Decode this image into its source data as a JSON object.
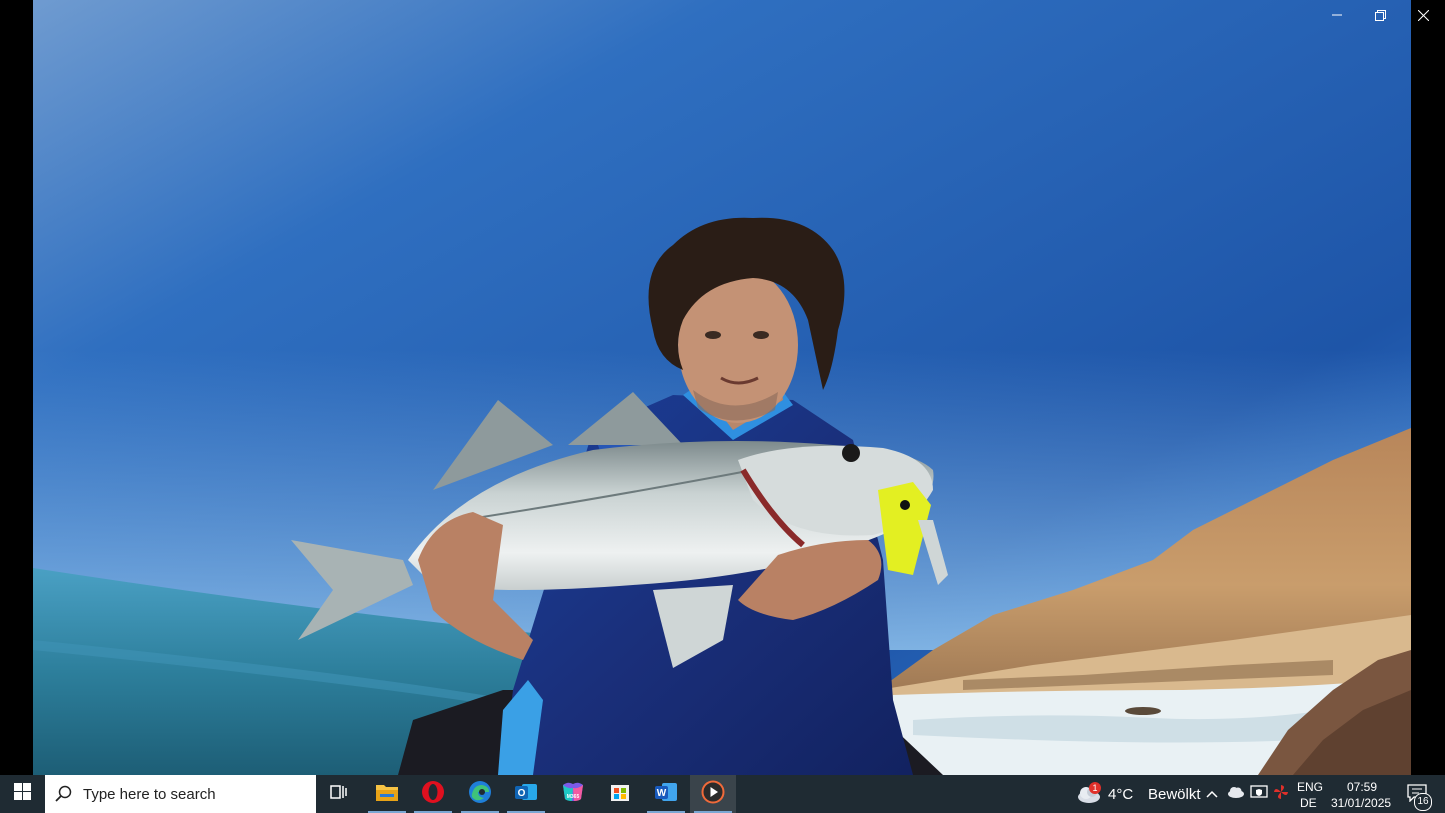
{
  "window": {
    "minimize_icon": "minimize-icon",
    "restore_icon": "restore-icon",
    "close_icon": "close-icon"
  },
  "photo": {
    "subject": "angler-holding-sea-bass"
  },
  "taskbar": {
    "search": {
      "placeholder": "Type here to search"
    },
    "apps": [
      {
        "name": "task-view-icon",
        "pinned": true
      },
      {
        "name": "file-explorer-icon",
        "pinned": true,
        "running": true
      },
      {
        "name": "opera-icon",
        "pinned": true,
        "running": true
      },
      {
        "name": "edge-icon",
        "pinned": true,
        "running": true
      },
      {
        "name": "outlook-icon",
        "pinned": true,
        "running": true
      },
      {
        "name": "m365-icon",
        "pinned": true,
        "label": "M365"
      },
      {
        "name": "store-icon",
        "pinned": true
      },
      {
        "name": "word-icon",
        "pinned": true,
        "running": true
      },
      {
        "name": "media-player-icon",
        "pinned": true,
        "running": true,
        "active": true
      }
    ],
    "weather": {
      "temperature": "4°C",
      "condition": "Bewölkt",
      "badge": "1"
    },
    "language": {
      "line1": "ENG",
      "line2": "DE"
    },
    "clock": {
      "time": "07:59",
      "date": "31/01/2025"
    },
    "notifications": {
      "count": "16"
    },
    "colors": {
      "taskbar_bg": "#1f2b33",
      "active_indicator": "#7aa7d3"
    }
  }
}
